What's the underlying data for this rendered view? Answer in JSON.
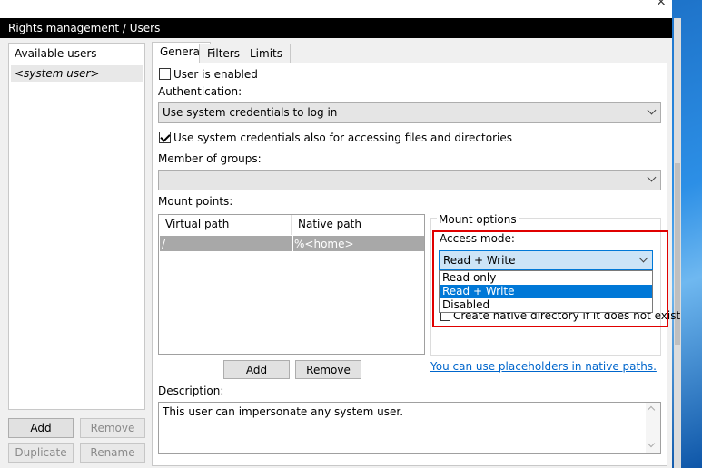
{
  "window": {
    "title": "Rights management / Users",
    "close_glyph": "×"
  },
  "users_panel": {
    "header": "Available users",
    "items": [
      "<system user>"
    ],
    "add_label": "Add",
    "remove_label": "Remove",
    "duplicate_label": "Duplicate",
    "rename_label": "Rename"
  },
  "tabs": [
    {
      "label": "General",
      "active": true
    },
    {
      "label": "Filters",
      "active": false
    },
    {
      "label": "Limits",
      "active": false
    }
  ],
  "general": {
    "user_enabled_label": "User is enabled",
    "user_enabled": false,
    "authentication_label": "Authentication:",
    "authentication_value": "Use system credentials to log in",
    "use_sys_creds_label": "Use system credentials also for accessing files and directories",
    "use_sys_creds": true,
    "member_groups_label": "Member of groups:",
    "member_groups_value": "",
    "mount_points_label": "Mount points:",
    "mount_columns": [
      "Virtual path",
      "Native path"
    ],
    "mount_rows": [
      {
        "virtual": "/",
        "native": "%<home>"
      }
    ],
    "mount_add_label": "Add",
    "mount_remove_label": "Remove",
    "mount_options_title": "Mount options",
    "access_mode_label": "Access mode:",
    "access_mode_value": "Read + Write",
    "access_mode_options": [
      "Read only",
      "Read + Write",
      "Disabled"
    ],
    "access_mode_selected_index": 1,
    "create_native_dir_label": "Create native directory if it does not exist",
    "placeholders_link": "You can use placeholders in native paths.",
    "description_label": "Description:",
    "description_value": "This user can impersonate any system user."
  },
  "colors": {
    "title_bar": "#000000",
    "highlight_frame": "#e00000",
    "selection": "#0078d7",
    "link": "#0066cc"
  }
}
